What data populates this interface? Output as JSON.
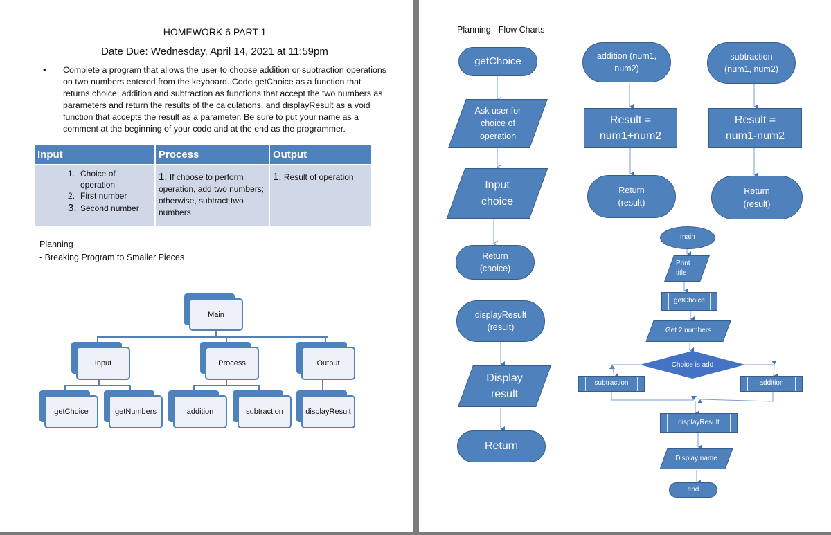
{
  "left_page": {
    "title": "HOMEWORK 6  PART 1",
    "due_date": "Date Due: Wednesday, April 14, 2021 at 11:59pm",
    "bullet": "•",
    "instructions": "Complete a program that allows the user to choose addition or subtraction operations on two numbers entered from the keyboard.  Code getChoice as a function that returns choice, addition and subtraction as functions that accept the two numbers as parameters and return the results of the calculations, and displayResult as a void function that accepts the result as a parameter.  Be sure to put your name as a comment at the beginning of your code and at the end as the programmer.",
    "ipo_table": {
      "headers": [
        "Input",
        "Process",
        "Output"
      ],
      "input_items": [
        {
          "num": "1.",
          "text": "Choice of operation"
        },
        {
          "num": "2.",
          "text": "First number"
        },
        {
          "num": "3.",
          "text": "Second number"
        }
      ],
      "process_items": [
        {
          "num": "1.",
          "text": "If choose to perform operation, add two numbers; otherwise, subtract two numbers"
        }
      ],
      "output_items": [
        {
          "num": "1.",
          "text": "Result of operation"
        }
      ]
    },
    "planning": "Planning",
    "breaking": "- Breaking Program to Smaller Pieces",
    "hierarchy": {
      "root": "Main",
      "level1": [
        "Input",
        "Process",
        "Output"
      ],
      "level2": [
        "getChoice",
        "getNumbers",
        "addition",
        "subtraction",
        "displayResult"
      ]
    }
  },
  "right_page": {
    "heading": "Planning - Flow Charts",
    "getchoice_flow": {
      "start": "getChoice",
      "ask": "Ask user for choice of operation",
      "input": "Input choice",
      "return": "Return (choice)"
    },
    "display_flow": {
      "start": "displayResult (result)",
      "display": "Display result",
      "return": "Return"
    },
    "addition_flow": {
      "start": "addition (num1, num2)",
      "calc_line1": "Result =",
      "calc_line2": "num1+num2",
      "return": "Return (result)"
    },
    "subtraction_flow": {
      "start": "subtraction (num1, num2)",
      "calc_line1": "Result =",
      "calc_line2": "num1-num2",
      "return": "Return (result)"
    },
    "main_flow": {
      "start": "main",
      "print": "Print title",
      "getchoice": "getChoice",
      "get_numbers": "Get 2 numbers",
      "decision": "Choice is add",
      "left_branch": "subtraction",
      "right_branch": "addition",
      "display": "displayResult",
      "display_name": "Display name",
      "end": "end"
    }
  },
  "colors": {
    "shape_fill": "#4f81bd",
    "shape_border": "#385d8a",
    "table_header": "#4f81bd",
    "table_body": "#d0d8e8",
    "divider": "#7a7a7a"
  }
}
